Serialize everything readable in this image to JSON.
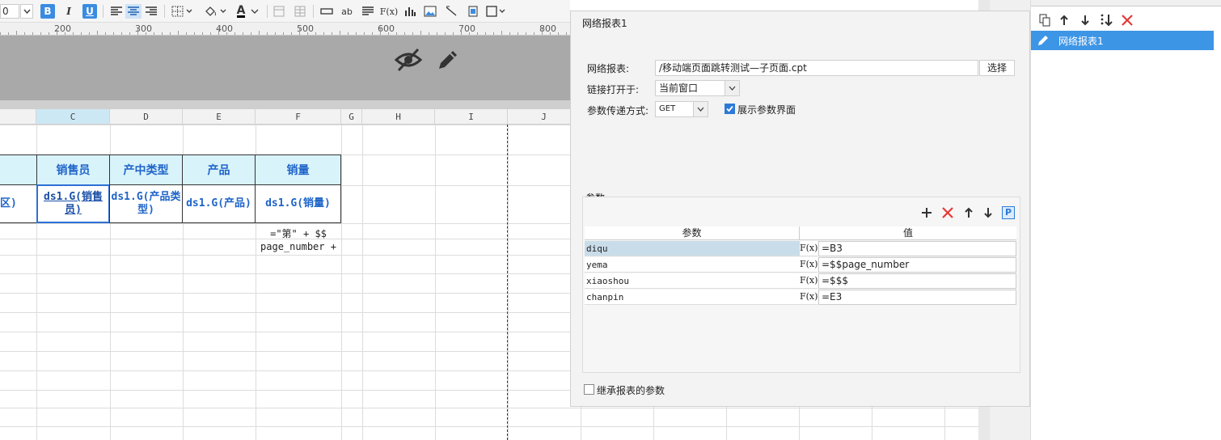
{
  "toolbar": {
    "font_size": "0",
    "bold": "B",
    "italic": "I",
    "underline": "U",
    "text_label": "ab",
    "fx_label": "F(x)",
    "font_color_label": "A"
  },
  "ruler": {
    "labels": [
      "200",
      "300",
      "400",
      "500",
      "600",
      "700",
      "800"
    ]
  },
  "grid": {
    "columns": [
      "C",
      "D",
      "E",
      "F",
      "G",
      "H",
      "I",
      "J"
    ],
    "selected_column": "C",
    "header_row": [
      "销售员",
      "产中类型",
      "产品",
      "销量"
    ],
    "left_partial_header": "",
    "left_partial_data": "区)",
    "data_row": [
      "ds1.G(销售员)",
      "ds1.G(产品类型)",
      "ds1.G(产品)",
      "ds1.G(销量)"
    ],
    "formula_line1": "=\"第\" + $$",
    "formula_line2": "page_number +"
  },
  "dialog": {
    "title": "网络报表1",
    "report_label": "网络报表:",
    "report_value": "/移动端页面跳转测试—子页面.cpt",
    "choose_button": "选择",
    "open_label": "链接打开于:",
    "open_value": "当前窗口",
    "method_label": "参数传递方式:",
    "method_value": "GET",
    "show_param_label": "展示参数界面",
    "show_param_checked": true,
    "params_section": "参数",
    "col_param": "参数",
    "col_value": "值",
    "params": [
      {
        "name": "diqu",
        "value": "=B3"
      },
      {
        "name": "yema",
        "value": "=$$page_number"
      },
      {
        "name": "xiaoshou",
        "value": "=$$$"
      },
      {
        "name": "chanpin",
        "value": "=E3"
      }
    ],
    "fx_label": "F(x)",
    "p_button": "P",
    "inherit_label": "继承报表的参数",
    "inherit_checked": false
  },
  "right_panel": {
    "items": [
      {
        "label": "网络报表1",
        "selected": true
      }
    ]
  },
  "colors": {
    "accent": "#3d95e6",
    "header_fill": "#d9f3fb",
    "cell_text": "#1e64c8",
    "delete": "#e53935"
  }
}
